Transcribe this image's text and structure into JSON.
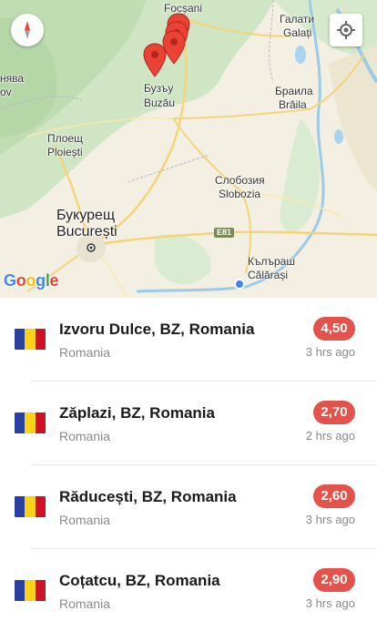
{
  "map": {
    "labels": {
      "focsani": "Focșani",
      "galati_cyr": "Галати",
      "galati": "Galați",
      "buzau_cyr": "Бузъу",
      "buzau": "Buzău",
      "braila_cyr": "Браила",
      "braila": "Brăila",
      "ploiesti_cyr": "Плоещ",
      "ploiesti": "Ploiești",
      "slobozia_cyr": "Слобозия",
      "slobozia": "Slobozia",
      "bucuresti_cyr": "Букурещ",
      "bucuresti": "București",
      "calarasi_cyr": "Кълъраш",
      "calarasi": "Călărași",
      "partial_left": "нява",
      "partial_left2": "ov",
      "road_e81": "E81"
    },
    "logo": {
      "g1": "G",
      "g2": "o",
      "g3": "o",
      "g4": "g",
      "g5": "l",
      "g6": "e"
    },
    "compass_icon": "compass-icon",
    "locate_icon": "my-location-icon",
    "pin_color": "#ea4335"
  },
  "locations": [
    {
      "name": "Izvoru Dulce, BZ, Romania",
      "country": "Romania",
      "value": "4,50",
      "time": "3 hrs ago"
    },
    {
      "name": "Zăplazi, BZ, Romania",
      "country": "Romania",
      "value": "2,70",
      "time": "2 hrs ago"
    },
    {
      "name": "Răducești, BZ, Romania",
      "country": "Romania",
      "value": "2,60",
      "time": "3 hrs ago"
    },
    {
      "name": "Coțatcu, BZ, Romania",
      "country": "Romania",
      "value": "2,90",
      "time": "3 hrs ago"
    }
  ],
  "flag_colors": {
    "blue": "#2b3f9c",
    "yellow": "#fcd116",
    "red": "#ce1126"
  },
  "badge_color": "#e3524b"
}
